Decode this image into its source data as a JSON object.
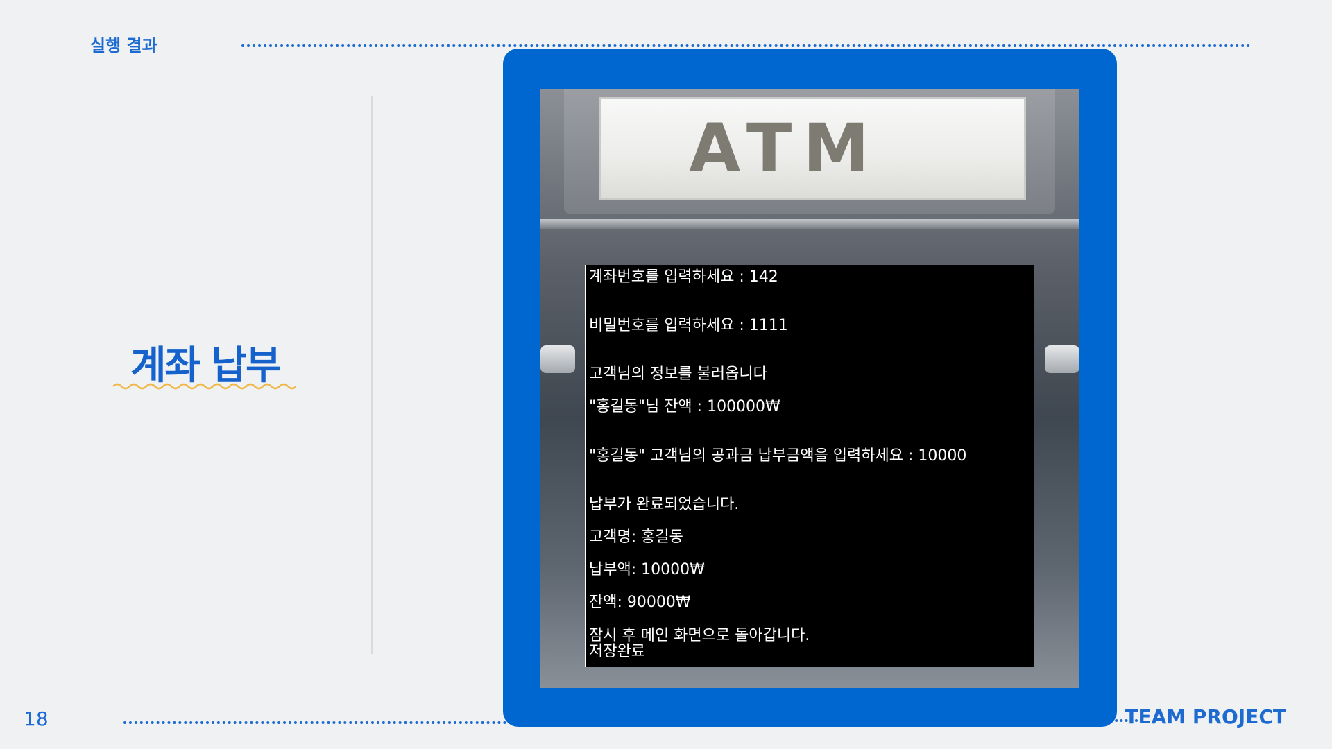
{
  "header": {
    "section_label": "실행 결과"
  },
  "main": {
    "heading": "계좌 납부"
  },
  "footer": {
    "page_number": "18",
    "team_label": "TEAM PROJECT"
  },
  "atm": {
    "sign": "ATM",
    "console_lines": [
      "계좌번호를 입력하세요 : 142",
      "비밀번호를 입력하세요 : 1111",
      "고객님의 정보를 불러옵니다",
      "\"홍길동\"님 잔액 : 100000₩",
      "\"홍길동\" 고객님의 공과금 납부금액을 입력하세요 : 10000",
      "납부가 완료되었습니다.",
      "고객명: 홍길동",
      "납부액: 10000₩",
      "잔액: 90000₩",
      "잠시 후 메인 화면으로 돌아갑니다.",
      "저장완료"
    ]
  },
  "colors": {
    "accent": "#1d6bd1",
    "frame": "#0067d1",
    "squiggle": "#f0b84a",
    "background": "#f0f1f3"
  }
}
